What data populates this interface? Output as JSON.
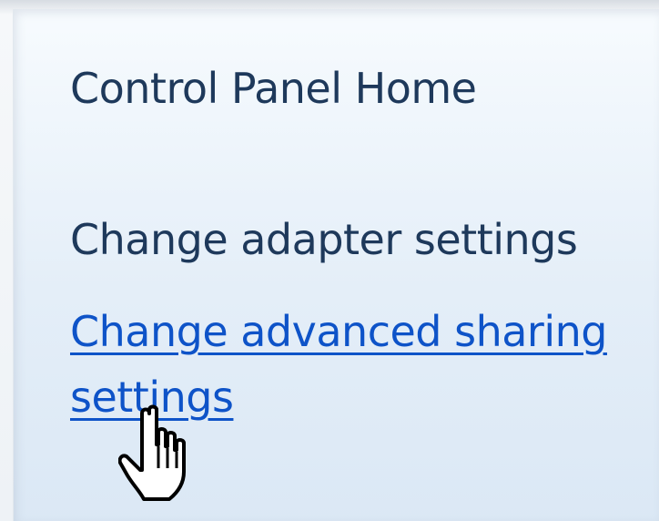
{
  "task_pane": {
    "links": [
      {
        "label": "Control Panel Home"
      },
      {
        "label": "Change adapter settings"
      },
      {
        "label": "Change advanced sharing settings"
      }
    ]
  },
  "cursor": {
    "icon": "hand-pointer-icon"
  },
  "colors": {
    "link_default": "#1e395b",
    "link_hover": "#0e53c8",
    "pane_bg_top": "#f7fbfe",
    "pane_bg_bottom": "#dbe8f5"
  }
}
